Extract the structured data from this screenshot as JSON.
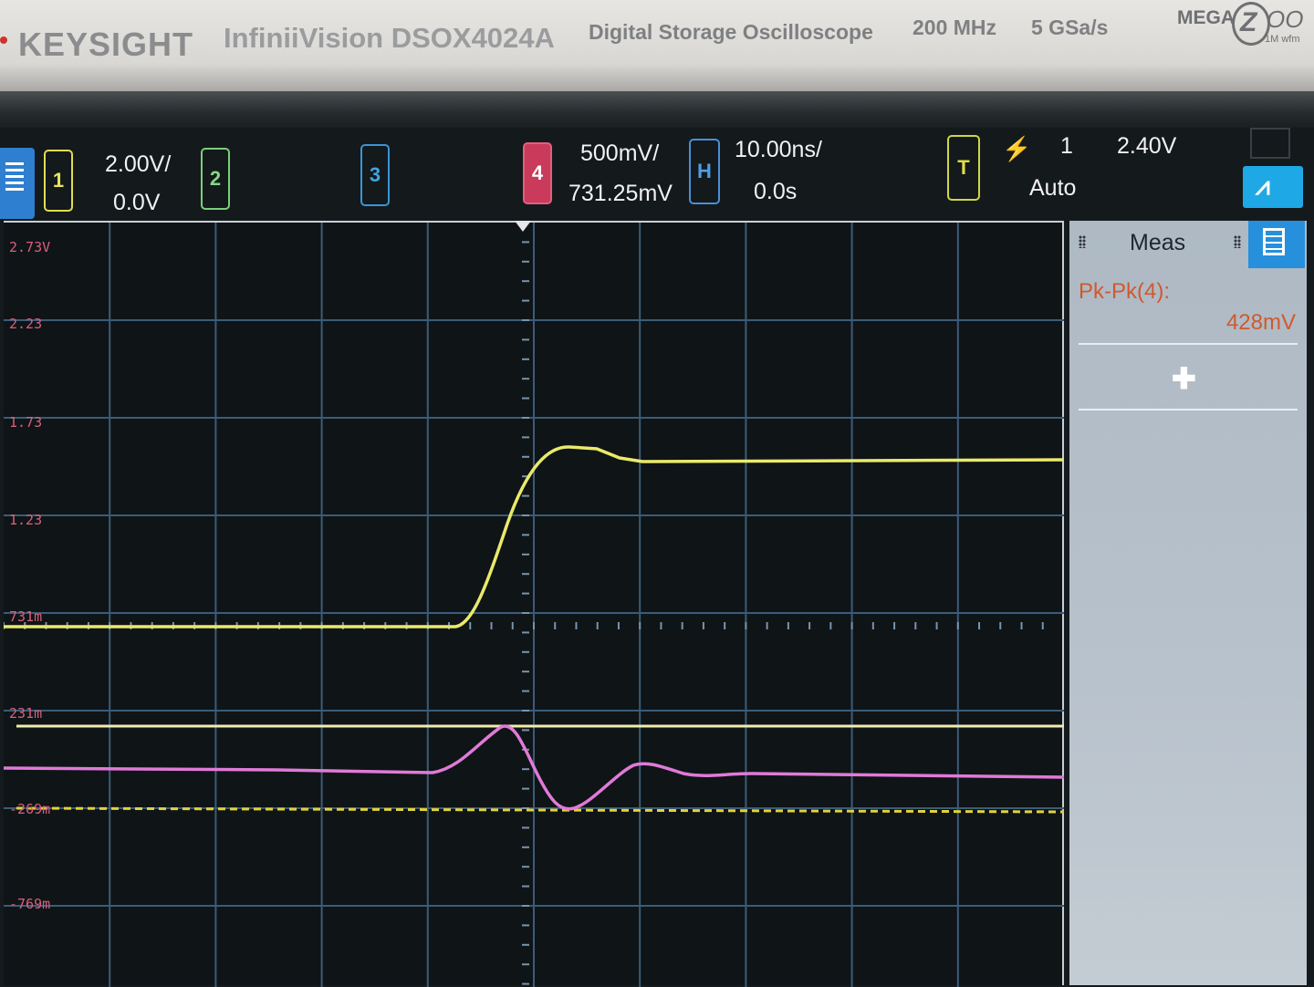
{
  "bezel": {
    "brand": "KEYSIGHT",
    "model": "InfiniiVision DSOX4024A",
    "description": "Digital Storage Oscilloscope",
    "bandwidth": "200 MHz",
    "sample_rate": "5 GSa/s",
    "zoom_logo": {
      "mega": "MEGA",
      "letter": "Z",
      "tail": "OO",
      "sub": "1M wfm"
    }
  },
  "channels": {
    "ch1": {
      "label": "1",
      "scale": "2.00V/",
      "offset": "0.0V",
      "color": "#e6e65a"
    },
    "ch2": {
      "label": "2",
      "color": "#7bcf7b"
    },
    "ch3": {
      "label": "3",
      "color": "#3996d6"
    },
    "ch4": {
      "label": "4",
      "scale": "500mV/",
      "offset": "731.25mV",
      "color": "#c93a5b"
    }
  },
  "horizontal": {
    "label": "H",
    "scale": "10.00ns/",
    "delay": "0.0s"
  },
  "trigger": {
    "label": "T",
    "source": "1",
    "level": "2.40V",
    "mode": "Auto",
    "icon": "trigger-edge-icon"
  },
  "graticule_labels": [
    "2.73V",
    "2.23",
    "1.73",
    "1.23",
    "731m",
    "231m",
    "-269m",
    "-769m"
  ],
  "measurements": {
    "title": "Meas",
    "items": [
      {
        "name": "Pk-Pk(4):",
        "value": "428mV"
      }
    ],
    "add_symbol": "✚"
  },
  "traces": {
    "ch1_color": "#eaea6a",
    "ch4_color": "#e07ad8",
    "cursor_color": "#f0ecb0"
  }
}
